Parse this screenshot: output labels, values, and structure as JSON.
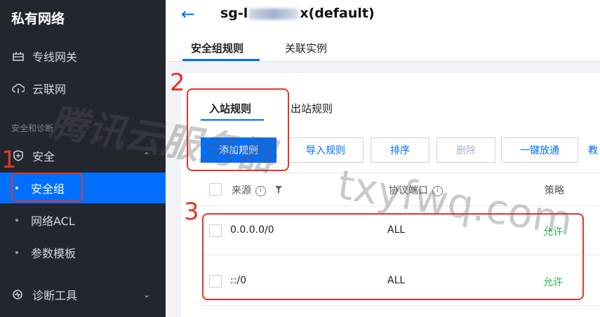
{
  "sidebar": {
    "title": "私有网络",
    "items": [
      {
        "label": "专线网关",
        "icon": "gateway-icon"
      },
      {
        "label": "云联网",
        "icon": "cloud-network-icon"
      }
    ],
    "group_label": "安全和诊断",
    "security": {
      "label": "安全",
      "icon": "shield-icon"
    },
    "sub_items": [
      {
        "label": "安全组"
      },
      {
        "label": "网络ACL"
      },
      {
        "label": "参数模板"
      }
    ],
    "diagnostics": {
      "label": "诊断工具",
      "icon": "diagnostic-icon"
    }
  },
  "header": {
    "title_prefix": "sg-l",
    "title_suffix": "x(default)",
    "tabs": [
      {
        "label": "安全组规则"
      },
      {
        "label": "关联实例"
      }
    ]
  },
  "rules": {
    "subtabs": [
      {
        "label": "入站规则"
      },
      {
        "label": "出站规则"
      }
    ],
    "buttons": {
      "add": "添加规则",
      "import": "导入规则",
      "sort": "排序",
      "delete": "删除",
      "allow_all": "一键放通",
      "teach": "教"
    },
    "columns": {
      "source": "来源",
      "protocol_port": "协议端口",
      "policy": "策略"
    },
    "rows": [
      {
        "source": "0.0.0.0/0",
        "port": "ALL",
        "policy": "允许"
      },
      {
        "source": "::/0",
        "port": "ALL",
        "policy": "允许"
      }
    ]
  },
  "annotations": {
    "n1": "1",
    "n2": "2",
    "n3": "3"
  },
  "watermark": {
    "text1": "腾讯云服务器",
    "text2": "txyfwq.com"
  },
  "colors": {
    "accent": "#006eff",
    "sidebar_bg": "#22262e",
    "annotation": "#e53629",
    "allow": "#29b34a"
  }
}
